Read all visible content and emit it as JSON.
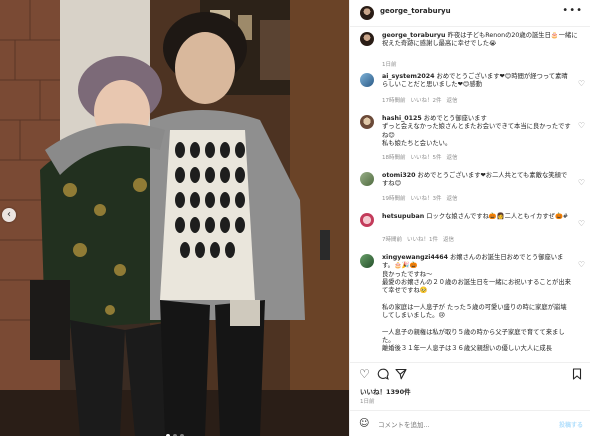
{
  "post": {
    "username": "george_toraburyu",
    "caption_user": "george_toraburyu",
    "caption_text": " 昨夜は子どもRenonの20歳の誕生日🎂一緒に祝えた奇跡に感謝し最高に幸せでした😭",
    "caption_time": "1日前",
    "likes": "いいね！1390件",
    "date": "1日前",
    "comment_placeholder": "コメントを追加...",
    "post_label": "投稿する",
    "nav_prev": "‹"
  },
  "comments": [
    {
      "user": "ai_system2024",
      "text": " おめでとうございます❤😊時間が経つって素晴らしいことだと思いました❤😊感動",
      "time": "17時間前",
      "likes": "いいね！2件",
      "reply": "返信"
    },
    {
      "user": "hashi_0125",
      "text": " おめでとう御座います\nずっと会えなかった娘さんとまたお会いできて本当に良かったですね😊\n私も娘たちと会いたい。",
      "time": "18時間前",
      "likes": "いいね！5件",
      "reply": "返信"
    },
    {
      "user": "otomi320",
      "text": " おめでとうございます❤お二人共とても素敵な笑顔ですね😊",
      "time": "19時間前",
      "likes": "いいね！3件",
      "reply": "返信"
    },
    {
      "user": "hetsupuban",
      "text": " ロックな娘さんですね🎃👩二人ともイカすぜ🎃#",
      "time": "7時間前",
      "likes": "いいね！1件",
      "reply": "返信"
    },
    {
      "user": "xingyewangzi4464",
      "text": " お嬢さんのお誕生日おめでとう御座います。🎂🎉🎃\n良かったですね〜\n最愛のお嬢さんの２０歳のお誕生日を一緒にお祝いすることが出来て幸せですね🥺\n\n私の家庭は一人息子が たった５歳の可愛い盛りの時に家庭が崩壊してしまいました。😢\n\n一人息子の親権は私が取り５歳の時から父子家庭で育てて来ました。\n離婚後３１年一人息子は３６歳父親想いの優しい大人に成長",
      "time": "",
      "likes": "",
      "reply": ""
    }
  ],
  "icons": {
    "more": "more-horizontal-icon",
    "like": "heart-icon",
    "comment": "comment-icon",
    "share": "share-icon",
    "save": "bookmark-icon",
    "emoji": "emoji-icon"
  },
  "colors": {
    "post_btn": "#b2dffc",
    "muted": "#8e8e8e"
  }
}
